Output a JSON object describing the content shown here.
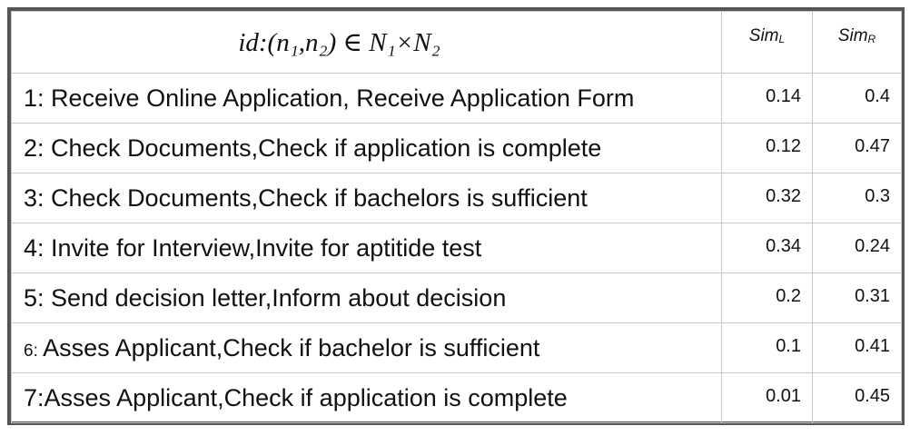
{
  "header": {
    "id_label": "id:(n₁,n₂) ∈ N₁×N₂",
    "sim_l_main": "Sim",
    "sim_l_sub": "L",
    "sim_r_main": "Sim",
    "sim_r_sub": "R"
  },
  "rows": [
    {
      "prefix": "1: ",
      "text": "Receive Online Application, Receive Application Form",
      "sim_l": "0.14",
      "sim_r": "0.4"
    },
    {
      "prefix": "2: ",
      "text": "Check Documents,Check if application is complete",
      "sim_l": "0.12",
      "sim_r": "0.47"
    },
    {
      "prefix": "3: ",
      "text": "Check Documents,Check if bachelors is sufficient",
      "sim_l": "0.32",
      "sim_r": "0.3"
    },
    {
      "prefix": "4: ",
      "text": "Invite for Interview,Invite for aptitide test",
      "sim_l": "0.34",
      "sim_r": "0.24"
    },
    {
      "prefix": "5: ",
      "text": "Send decision letter,Inform about decision",
      "sim_l": "0.2",
      "sim_r": "0.31"
    },
    {
      "prefix": "6: ",
      "text": "Asses Applicant,Check if bachelor is sufficient",
      "sim_l": "0.1",
      "sim_r": "0.41"
    },
    {
      "prefix": "7:",
      "text": "Asses Applicant,Check if application is complete",
      "sim_l": "0.01",
      "sim_r": "0.45"
    }
  ]
}
